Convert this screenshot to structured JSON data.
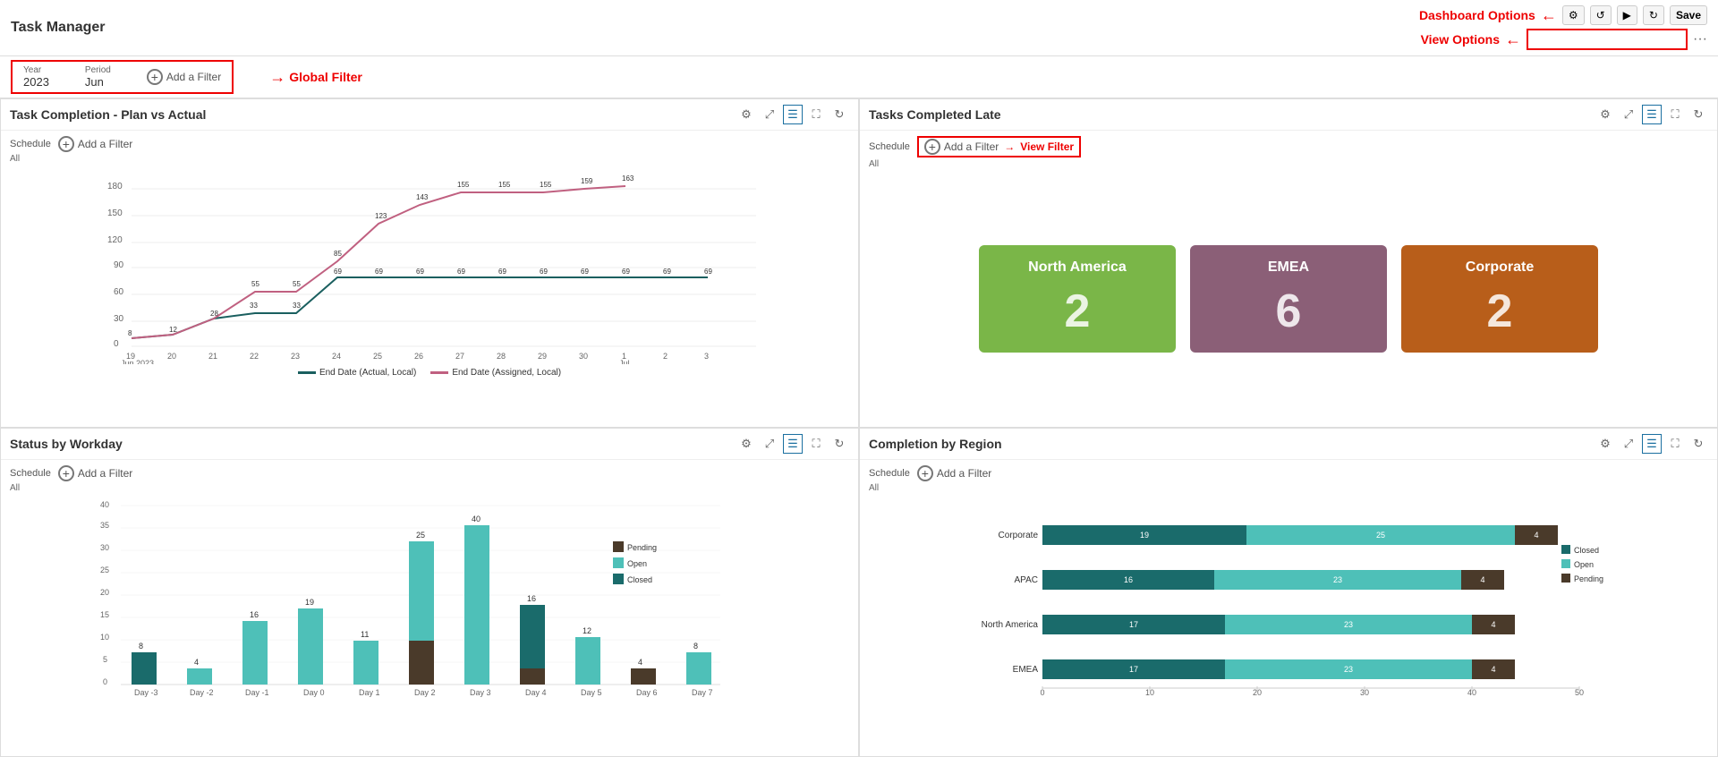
{
  "app": {
    "title": "Task Manager"
  },
  "header": {
    "dashboard_options_label": "Dashboard Options",
    "view_options_label": "View Options",
    "save_label": "Save",
    "toolbar_icons": [
      "⚙",
      "↺",
      "▶",
      "↻"
    ]
  },
  "global_filter": {
    "year_label": "Year",
    "year_value": "2023",
    "period_label": "Period",
    "period_value": "Jun",
    "add_filter_label": "Add a Filter",
    "global_filter_annotation": "Global Filter"
  },
  "panels": {
    "task_completion": {
      "title": "Task Completion - Plan vs Actual",
      "schedule_label": "Schedule",
      "schedule_value": "All",
      "add_filter_label": "Add a Filter",
      "legend": [
        {
          "label": "End Date (Actual, Local)",
          "color": "#1a5f5f"
        },
        {
          "label": "End Date (Assigned, Local)",
          "color": "#c06080"
        }
      ],
      "x_labels": [
        "19\nJun 2023",
        "20",
        "21",
        "22",
        "23",
        "24",
        "25",
        "26",
        "27",
        "28",
        "29",
        "30",
        "1\nJul",
        "2",
        "3"
      ],
      "y_labels": [
        "0",
        "30",
        "60",
        "90",
        "120",
        "150",
        "180"
      ],
      "actual_values": [
        8,
        12,
        28,
        33,
        33,
        69,
        69,
        69,
        69,
        69,
        69,
        69,
        69,
        69,
        69
      ],
      "assigned_values": [
        8,
        12,
        28,
        55,
        55,
        85,
        123,
        143,
        155,
        155,
        155,
        159,
        163,
        null,
        null
      ],
      "data_labels_actual": [
        "8",
        "12",
        "28",
        "33",
        "33",
        "69",
        "69",
        "69",
        "69",
        "69",
        "69",
        "69",
        "69",
        "69",
        "69"
      ],
      "data_labels_assigned": [
        "8",
        "12",
        "28",
        "55",
        "55",
        "85",
        "123",
        "143",
        "155",
        "155",
        "155",
        "159",
        "163"
      ]
    },
    "tasks_completed_late": {
      "title": "Tasks Completed Late",
      "schedule_label": "Schedule",
      "schedule_value": "All",
      "add_filter_label": "Add a Filter",
      "view_filter_annotation": "View Filter",
      "regions": [
        {
          "name": "North America",
          "value": "2",
          "color_class": "green"
        },
        {
          "name": "EMEA",
          "value": "6",
          "color_class": "mauve"
        },
        {
          "name": "Corporate",
          "value": "2",
          "color_class": "orange"
        }
      ]
    },
    "status_by_workday": {
      "title": "Status by Workday",
      "schedule_label": "Schedule",
      "schedule_value": "All",
      "add_filter_label": "Add a Filter",
      "legend": [
        {
          "label": "Pending",
          "color": "#4a3a2a"
        },
        {
          "label": "Open",
          "color": "#4ec0b8"
        },
        {
          "label": "Closed",
          "color": "#1a6b6b"
        }
      ],
      "bars": [
        {
          "day": "Day -3",
          "pending": 0,
          "open": 0,
          "closed": 8
        },
        {
          "day": "Day -2",
          "pending": 0,
          "open": 4,
          "closed": 0
        },
        {
          "day": "Day -1",
          "pending": 0,
          "open": 16,
          "closed": 0
        },
        {
          "day": "Day 0",
          "pending": 0,
          "open": 19,
          "closed": 0
        },
        {
          "day": "Day 1",
          "pending": 0,
          "open": 11,
          "closed": 0
        },
        {
          "day": "Day 2",
          "pending": 11,
          "open": 25,
          "closed": 0
        },
        {
          "day": "Day 3",
          "pending": 0,
          "open": 40,
          "closed": 0
        },
        {
          "day": "Day 4",
          "pending": 4,
          "open": 0,
          "closed": 16
        },
        {
          "day": "Day 5",
          "pending": 0,
          "open": 12,
          "closed": 0
        },
        {
          "day": "Day 6",
          "pending": 4,
          "open": 0,
          "closed": 0
        },
        {
          "day": "Day 7",
          "pending": 0,
          "open": 8,
          "closed": 0
        }
      ],
      "y_max": 45
    },
    "completion_by_region": {
      "title": "Completion by Region",
      "schedule_label": "Schedule",
      "schedule_value": "All",
      "add_filter_label": "Add a Filter",
      "legend": [
        {
          "label": "Closed",
          "color": "#1a6b6b"
        },
        {
          "label": "Open",
          "color": "#4ec0b8"
        },
        {
          "label": "Pending",
          "color": "#4a3a2a"
        }
      ],
      "rows": [
        {
          "region": "Corporate",
          "closed": 19,
          "open": 25,
          "pending": 4
        },
        {
          "region": "APAC",
          "closed": 16,
          "open": 23,
          "pending": 4
        },
        {
          "region": "North America",
          "closed": 17,
          "open": 23,
          "pending": 4
        },
        {
          "region": "EMEA",
          "closed": 17,
          "open": 23,
          "pending": 4
        }
      ],
      "x_labels": [
        "0",
        "10",
        "20",
        "30",
        "40",
        "50"
      ]
    }
  }
}
